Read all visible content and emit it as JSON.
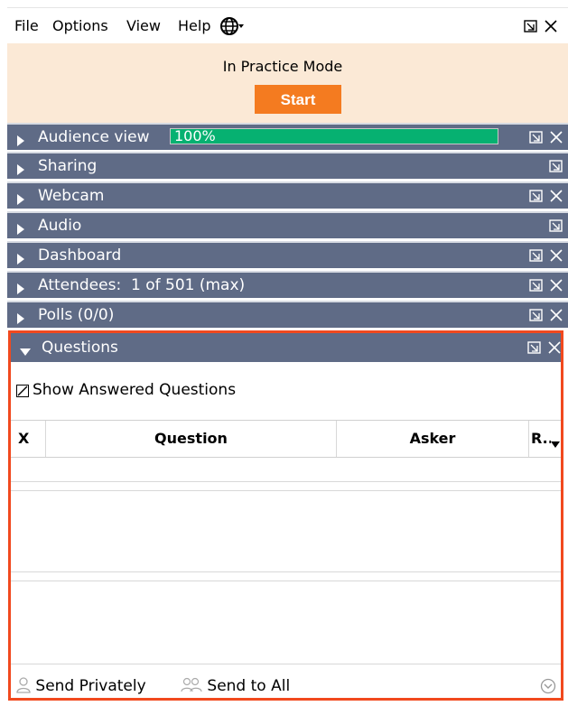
{
  "menubar": {
    "items": [
      "File",
      "Options",
      "View",
      "Help"
    ],
    "language_icon": "globe-icon",
    "controls": [
      "restore-icon",
      "close-icon"
    ]
  },
  "practice": {
    "label": "In Practice Mode",
    "start_label": "Start",
    "colors": {
      "bg": "#fbe9d6",
      "button": "#f47b20"
    }
  },
  "panels": [
    {
      "label": "Audience view",
      "progress": {
        "value": 100,
        "text": "100%"
      },
      "restore": true,
      "close": true
    },
    {
      "label": "Sharing",
      "restore": true,
      "close": false
    },
    {
      "label": "Webcam",
      "restore": true,
      "close": true
    },
    {
      "label": "Audio",
      "restore": true,
      "close": false
    },
    {
      "label": "Dashboard",
      "restore": true,
      "close": true
    },
    {
      "label": "Attendees:  1 of 501 (max)",
      "restore": true,
      "close": true
    },
    {
      "label": "Polls (0/0)",
      "restore": true,
      "close": true
    },
    {
      "label": "Questions",
      "restore": true,
      "close": true,
      "expanded": true
    }
  ],
  "questions": {
    "show_answered_label": "Show Answered Questions",
    "show_answered_checked": true,
    "columns": [
      "X",
      "Question",
      "Asker",
      "R..."
    ],
    "rows": [],
    "actions": {
      "send_privately": "Send Privately",
      "send_to_all": "Send to All"
    }
  },
  "colors": {
    "panel_header": "#5f6b86",
    "progress_fill": "#06b171",
    "highlight_border": "#f1491e"
  }
}
